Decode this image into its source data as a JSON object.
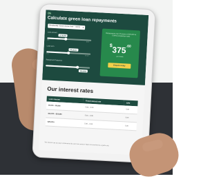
{
  "app": {
    "logo_text": "Bk"
  },
  "calculator": {
    "title": "Calculate green loan repayments",
    "select_value": "Residential / Green home loan – owner occupied",
    "sliders": [
      {
        "label": "Loan amount",
        "value": "$ 70,000",
        "min": "$5k",
        "max": "$3m",
        "level": 0.42
      },
      {
        "label": "Loan term",
        "value": "30 years",
        "min": "1 yr",
        "max": "30 yrs",
        "level": 0.5
      },
      {
        "label": "Repayment frequency",
        "value": "Monthly",
        "min": "",
        "max": "",
        "level": 0.72
      }
    ],
    "result": {
      "label": "Repayments over 30 years on $70,000 at 5.00% (comparison rate)",
      "currency": "$",
      "amount": "375",
      "cents": ".60",
      "sub": "per month",
      "button": "Enquire today"
    }
  },
  "rates": {
    "title": "Our interest rates",
    "columns": [
      "Loan amount",
      "Fixed interest rate",
      "APR"
    ],
    "rows": [
      [
        "$5,000 – $9,999",
        "5.00 – 6.00",
        "5.05"
      ],
      [
        "$10,000 – $24,999",
        "5.00 – 6.00",
        "5.05"
      ],
      [
        "$25,000+",
        "5.00 – 6.00",
        "5.05"
      ]
    ],
    "footnote": "The interest rate you pay is determined by your loan amount. Rates are provided as a guide only."
  },
  "colors": {
    "panel": "#1d4a3f",
    "accent_green": "#27894c",
    "button_yellow": "#f2cf4a"
  }
}
